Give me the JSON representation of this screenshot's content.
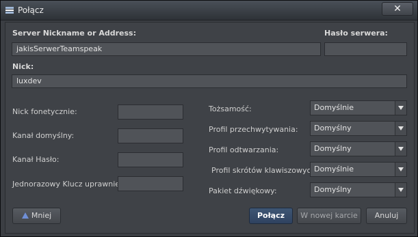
{
  "window": {
    "title": "Połącz",
    "close_glyph": "✕"
  },
  "form": {
    "server_label": "Server Nickname or Address:",
    "server_value": "jakisSerwerTeamspeak",
    "password_label": "Hasło serwera:",
    "password_value": "",
    "nick_label": "Nick:",
    "nick_value": "luxdev",
    "left_fields": [
      {
        "label": "Nick fonetycznie:",
        "value": ""
      },
      {
        "label": "Kanał domyślny:",
        "value": ""
      },
      {
        "label": "Kanał Hasło:",
        "value": ""
      },
      {
        "label": "Jednorazowy Klucz uprawnień:",
        "value": ""
      }
    ],
    "right_fields": [
      {
        "label": "Tożsamość:",
        "value": "Domyślnie"
      },
      {
        "label": "Profil przechwytywania:",
        "value": "Domyślny"
      },
      {
        "label": "Profil odtwarzania:",
        "value": "Domyślny"
      },
      {
        "label": "Profil skrótów klawiszowych:",
        "value": "Domyślnie"
      },
      {
        "label": "Pakiet dźwiękowy:",
        "value": "Domyślny"
      }
    ]
  },
  "buttons": {
    "less": "Mniej",
    "connect": "Połącz",
    "new_tab": "W nowej karcie",
    "cancel": "Anuluj"
  },
  "icons": {
    "app": "teamspeak-icon",
    "less": "triangle-up-icon",
    "dropdown": "chevron-down-icon"
  }
}
